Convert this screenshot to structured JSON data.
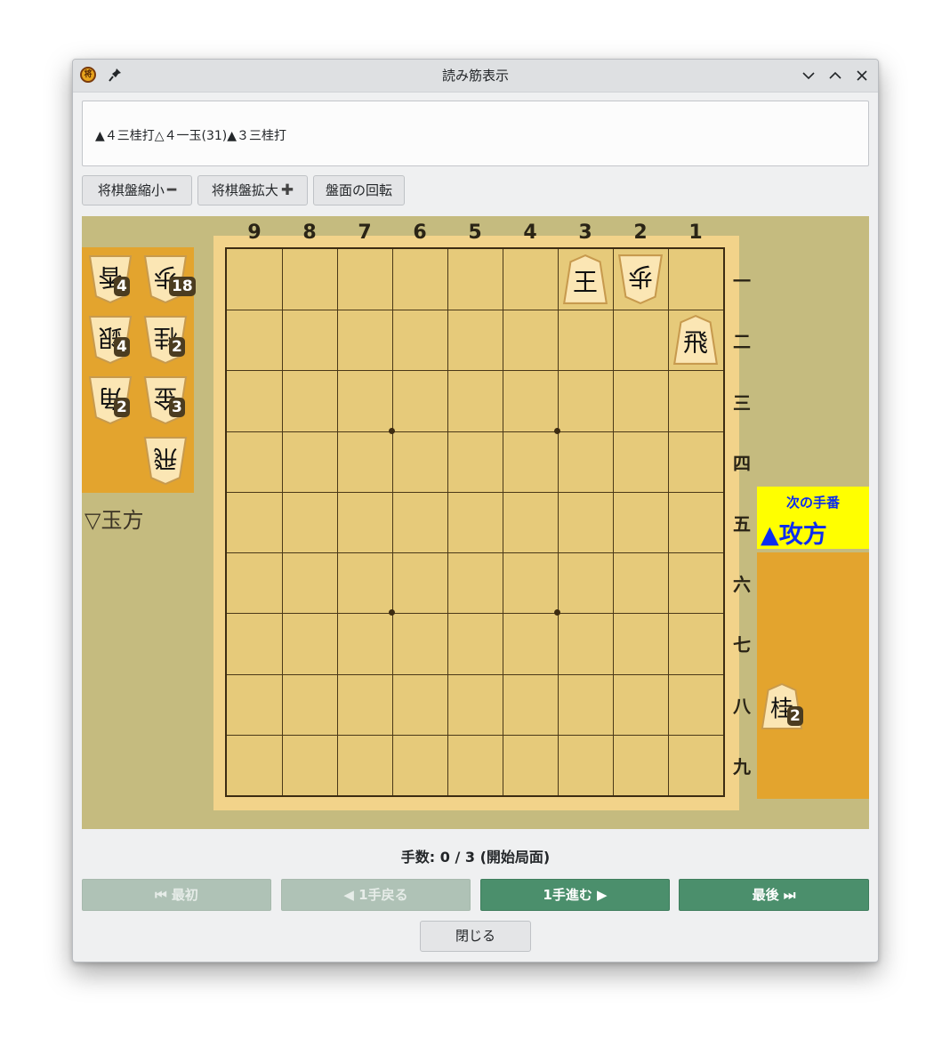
{
  "window": {
    "title": "読み筋表示"
  },
  "pv": {
    "text": "▲４三桂打△４一玉(31)▲３三桂打"
  },
  "toolbar": {
    "shrink_label": "将棋盤縮小",
    "shrink_symbol": "━",
    "enlarge_label": "将棋盤拡大",
    "enlarge_symbol": "✚",
    "rotate_label": "盤面の回転"
  },
  "board": {
    "files": [
      "9",
      "8",
      "7",
      "6",
      "5",
      "4",
      "3",
      "2",
      "1"
    ],
    "ranks": [
      "一",
      "二",
      "三",
      "四",
      "五",
      "六",
      "七",
      "八",
      "九"
    ],
    "pieces": [
      {
        "file": 3,
        "rank": 1,
        "char": "王",
        "side": "sente"
      },
      {
        "file": 2,
        "rank": 1,
        "char": "歩",
        "side": "gote"
      },
      {
        "file": 1,
        "rank": 2,
        "char": "飛",
        "side": "sente"
      }
    ]
  },
  "gote_hand": {
    "label": "▽玉方",
    "pieces": [
      {
        "char": "香",
        "count": "4"
      },
      {
        "char": "歩",
        "count": "18"
      },
      {
        "char": "銀",
        "count": "4"
      },
      {
        "char": "桂",
        "count": "2"
      },
      {
        "char": "角",
        "count": "2"
      },
      {
        "char": "金",
        "count": "3"
      },
      {
        "char": "飛",
        "count": ""
      }
    ]
  },
  "sente_hand": {
    "pieces": [
      {
        "char": "桂",
        "count": "2"
      }
    ]
  },
  "turn": {
    "caption": "次の手番",
    "side": "▲攻方",
    "bg_color": "#ffff00",
    "text_color": "#0b2cf0"
  },
  "status": {
    "move_count": "手数: 0 / 3 (開始局面)"
  },
  "nav": {
    "first_label": "⏮ 最初",
    "back_label": "◀ 1手戻る",
    "forward_label": "1手進む ▶",
    "last_label": "最後 ⏭"
  },
  "close_label": "閉じる",
  "colors": {
    "accent": "#4b8f6c",
    "hand_bg": "#e3a42e",
    "board": "#e6ca7a"
  }
}
